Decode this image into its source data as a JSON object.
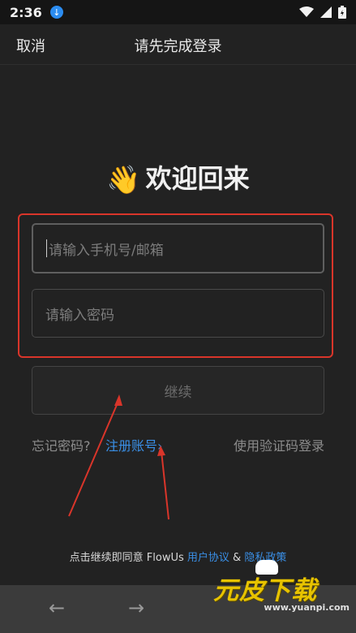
{
  "status_bar": {
    "time": "2:36",
    "icons": [
      "download-icon",
      "wifi-icon",
      "signal-icon",
      "battery-icon"
    ]
  },
  "header": {
    "cancel_label": "取消",
    "title": "请先完成登录"
  },
  "main": {
    "welcome_emoji": "👋",
    "welcome_text": "欢迎回来",
    "account_input": {
      "placeholder": "请输入手机号/邮箱",
      "value": ""
    },
    "password_input": {
      "placeholder": "请输入密码",
      "value": ""
    },
    "continue_label": "继续",
    "forgot_password": "忘记密码?",
    "register_label": "注册账号",
    "register_chevron": "›",
    "sms_login_label": "使用验证码登录"
  },
  "agreement": {
    "prefix": "点击继续即同意 FlowUs ",
    "user_agreement": "用户协议",
    "separator": " & ",
    "privacy_policy": "隐私政策"
  },
  "navbar": {
    "back_glyph": "←",
    "forward_glyph": "→"
  },
  "watermark": {
    "text": "元皮下载",
    "url": "www.yuanpi.com"
  },
  "colors": {
    "background": "#222222",
    "accent_link": "#3a8fe6",
    "annotation_red": "#d9352a"
  }
}
